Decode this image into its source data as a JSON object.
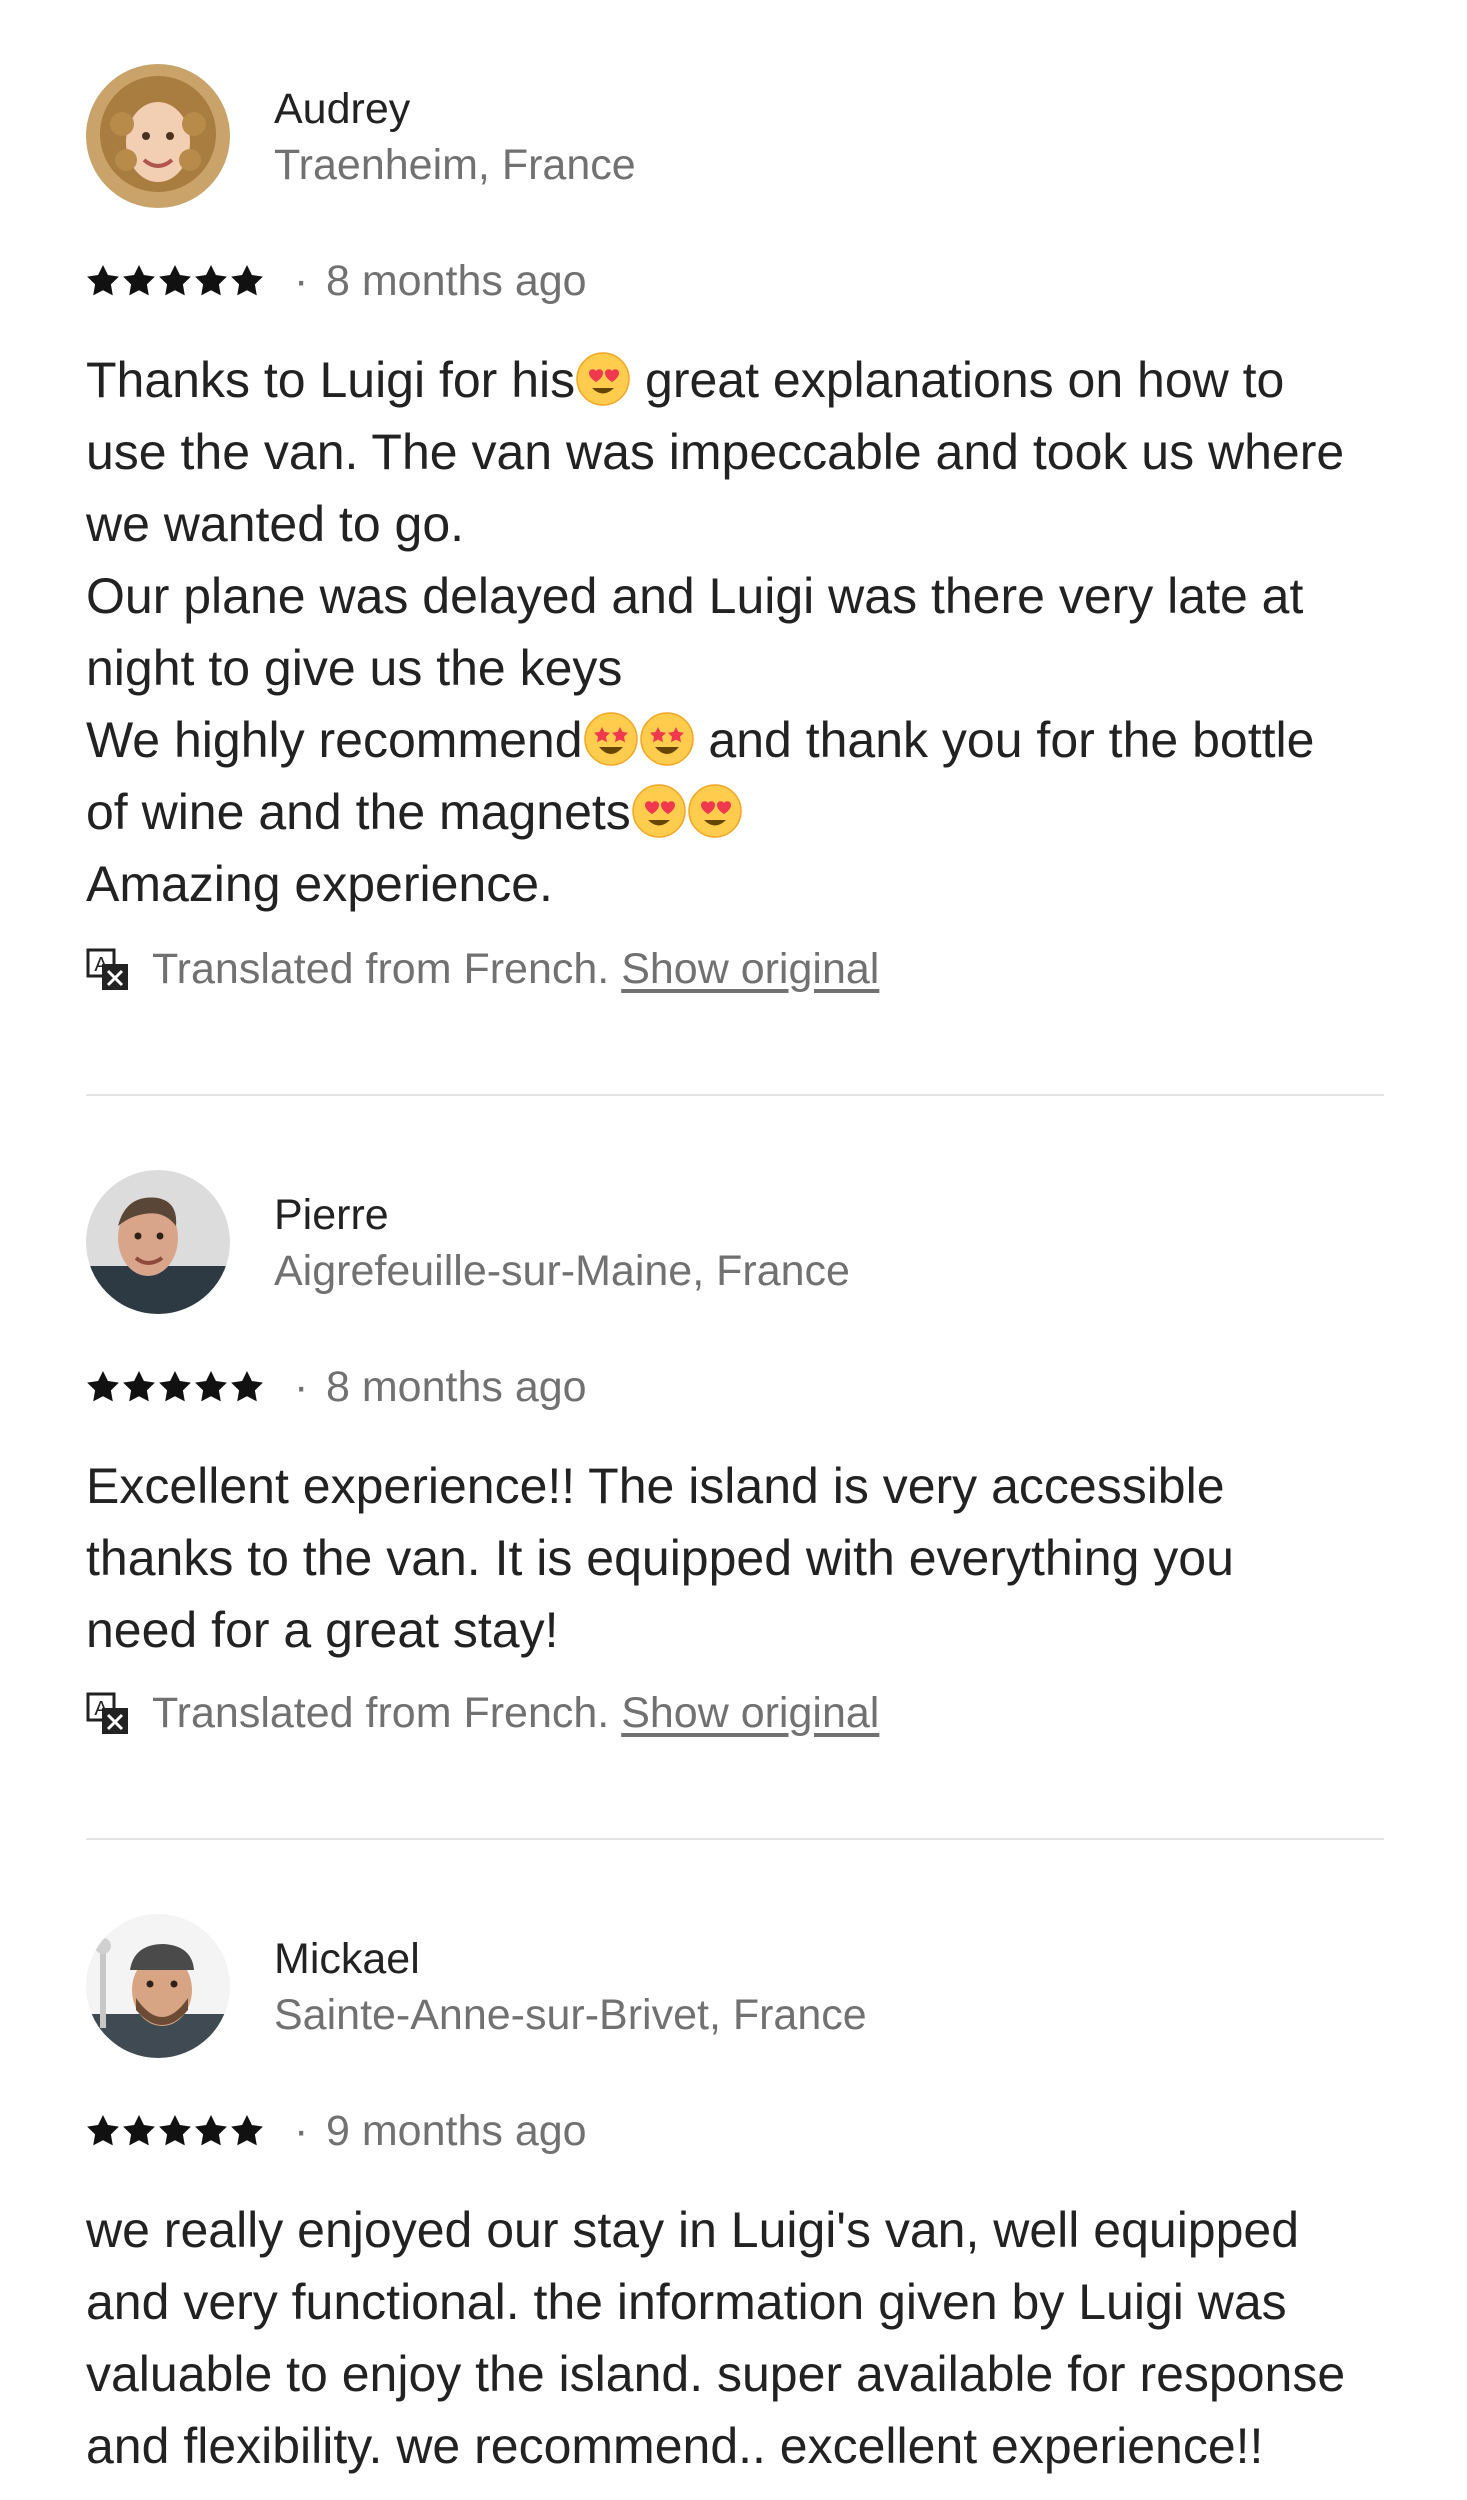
{
  "colors": {
    "text_primary": "#222222",
    "text_secondary": "#717171",
    "divider": "#e4e4e4",
    "star": "#111111"
  },
  "translate_icon": "translate-icon",
  "reviews": [
    {
      "name": "Audrey",
      "location": "Traenheim, France",
      "rating": 5,
      "date": "8 months ago",
      "separator": "·",
      "lines": [
        {
          "segments": [
            {
              "text": "Thanks to Luigi for his"
            },
            {
              "emoji": "heart-eyes"
            },
            {
              "text": " great explanations on how to"
            }
          ]
        },
        {
          "segments": [
            {
              "text": "use the van. The van was impeccable and took us where"
            }
          ]
        },
        {
          "segments": [
            {
              "text": "we wanted to go."
            }
          ]
        },
        {
          "segments": [
            {
              "text": "Our plane was delayed and Luigi was there very late at"
            }
          ]
        },
        {
          "segments": [
            {
              "text": "night to give us the keys"
            }
          ]
        },
        {
          "segments": [
            {
              "text": "We highly recommend"
            },
            {
              "emoji": "star-struck"
            },
            {
              "emoji": "star-struck"
            },
            {
              "text": " and thank you for the bottle"
            }
          ]
        },
        {
          "segments": [
            {
              "text": "of wine and the magnets"
            },
            {
              "emoji": "heart-eyes"
            },
            {
              "emoji": "heart-eyes"
            }
          ]
        },
        {
          "segments": [
            {
              "text": "Amazing experience."
            }
          ]
        }
      ],
      "translation_note": "Translated from French.",
      "show_original": "Show original"
    },
    {
      "name": "Pierre",
      "location": "Aigrefeuille-sur-Maine, France",
      "rating": 5,
      "date": "8 months ago",
      "separator": "·",
      "lines": [
        {
          "segments": [
            {
              "text": "Excellent experience!! The island is very accessible"
            }
          ]
        },
        {
          "segments": [
            {
              "text": "thanks to the van. It is equipped with everything you"
            }
          ]
        },
        {
          "segments": [
            {
              "text": "need for a great stay!"
            }
          ]
        }
      ],
      "translation_note": "Translated from French.",
      "show_original": "Show original"
    },
    {
      "name": "Mickael",
      "location": "Sainte-Anne-sur-Brivet, France",
      "rating": 5,
      "date": "9 months ago",
      "separator": "·",
      "lines": [
        {
          "segments": [
            {
              "text": "we really enjoyed our stay in Luigi's van, well equipped"
            }
          ]
        },
        {
          "segments": [
            {
              "text": "and very functional. the information given by Luigi was"
            }
          ]
        },
        {
          "segments": [
            {
              "text": "valuable to enjoy the island. super available for response"
            }
          ]
        },
        {
          "segments": [
            {
              "text": "and flexibility. we recommend.. excellent experience!!"
            }
          ]
        }
      ],
      "translation_note": "",
      "show_original": ""
    }
  ]
}
